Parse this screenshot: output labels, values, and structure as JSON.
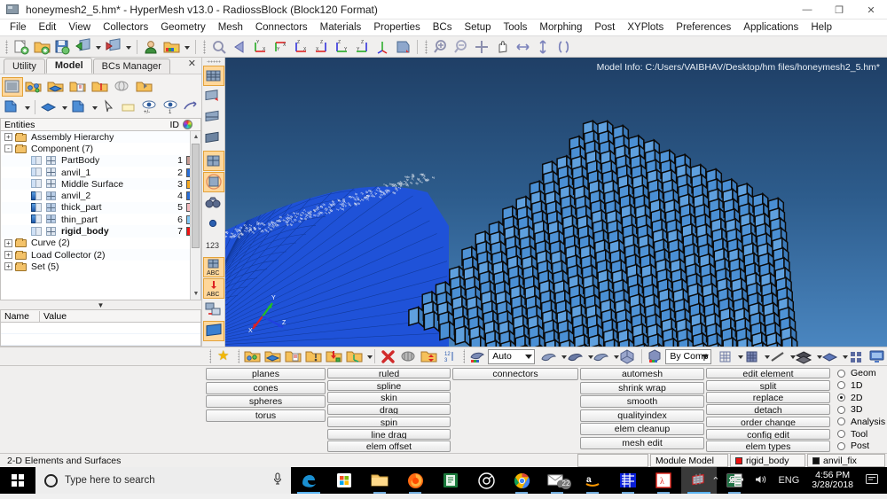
{
  "window": {
    "title": "honeymesh2_5.hm* - HyperMesh v13.0 - RadiossBlock (Block120 Format)",
    "minimize": "—",
    "maximize": "❐",
    "close": "✕"
  },
  "menubar": {
    "items": [
      "File",
      "Edit",
      "View",
      "Collectors",
      "Geometry",
      "Mesh",
      "Connectors",
      "Materials",
      "Properties",
      "BCs",
      "Setup",
      "Tools",
      "Morphing",
      "Post",
      "XYPlots",
      "Preferences",
      "Applications",
      "Help"
    ]
  },
  "toolbar_top": {
    "icons": [
      "new-session-icon",
      "open-model-icon",
      "save-model-icon",
      "import-solver-deck-icon",
      "export-solver-deck-icon",
      "user-profile-icon",
      "color-folder-icon",
      "zoom-window-icon",
      "undo-view-icon",
      "xy-view-icon",
      "yx-view-icon",
      "zx-view-icon",
      "xz-view-icon",
      "zy-view-icon",
      "yz-view-icon",
      "iso-view-icon",
      "flip-view-icon",
      "zoom-in-icon",
      "zoom-out-icon",
      "fit-view-icon",
      "pan-icon",
      "arrow-horizontal-icon",
      "arrow-vertical-icon",
      "circle-center-icon"
    ]
  },
  "left_panel": {
    "tabs": [
      {
        "label": "Utility",
        "active": false
      },
      {
        "label": "Model",
        "active": true
      },
      {
        "label": "BCs Manager",
        "active": false
      }
    ],
    "close_label": "✕",
    "toolbar_row1": [
      "model-browser-icon",
      "assembly-icon",
      "component-icon",
      "include-icon",
      "load-collector-icon",
      "system-icon",
      "property-icon"
    ],
    "toolbar_row2": [
      "display-component-icon",
      "display-geom-icon",
      "display-mesh-icon",
      "select-arrow-icon",
      "note-icon",
      "show-hide-all-icon",
      "isolate-icon",
      "reverse-icon"
    ],
    "headers": {
      "entities": "Entities",
      "id": "ID",
      "color": "color-wheel-icon"
    },
    "tree": [
      {
        "label": "Assembly Hierarchy",
        "id": "",
        "color": "",
        "depth": 0,
        "expander": "+",
        "icon": "assembly-folder-icon",
        "bold": false
      },
      {
        "label": "Component (7)",
        "id": "",
        "color": "",
        "depth": 0,
        "expander": "-",
        "icon": "component-folder-icon",
        "bold": false
      },
      {
        "label": "PartBody",
        "id": "1",
        "color": "#c49a92",
        "depth": 1,
        "expander": "",
        "icon": "component-off-icon",
        "bold": false
      },
      {
        "label": "anvil_1",
        "id": "2",
        "color": "#2a6fd8",
        "depth": 1,
        "expander": "",
        "icon": "component-off-icon",
        "bold": false
      },
      {
        "label": "Middle Surface",
        "id": "3",
        "color": "#f4a71d",
        "depth": 1,
        "expander": "",
        "icon": "component-off-icon",
        "bold": false
      },
      {
        "label": "anvil_2",
        "id": "4",
        "color": "#2a6fd8",
        "depth": 1,
        "expander": "",
        "icon": "component-on-icon",
        "bold": false
      },
      {
        "label": "thick_part",
        "id": "5",
        "color": "#f3b9bd",
        "depth": 1,
        "expander": "",
        "icon": "component-on-icon",
        "bold": false
      },
      {
        "label": "thin_part",
        "id": "6",
        "color": "#7ec5f2",
        "depth": 1,
        "expander": "",
        "icon": "component-on-icon",
        "bold": false
      },
      {
        "label": "rigid_body",
        "id": "7",
        "color": "#ef1111",
        "depth": 1,
        "expander": "",
        "icon": "component-off-icon",
        "bold": true
      },
      {
        "label": "Curve (2)",
        "id": "",
        "color": "",
        "depth": 0,
        "expander": "+",
        "icon": "curve-folder-icon",
        "bold": false
      },
      {
        "label": "Load Collector (2)",
        "id": "",
        "color": "",
        "depth": 0,
        "expander": "+",
        "icon": "load-collector-folder-icon",
        "bold": false
      },
      {
        "label": "Set (5)",
        "id": "",
        "color": "",
        "depth": 0,
        "expander": "+",
        "icon": "set-folder-icon",
        "bold": false
      }
    ],
    "property_table": {
      "columns": [
        "Name",
        "Value"
      ],
      "rows": []
    }
  },
  "vertical_toolbar": {
    "icons": [
      "mesh-display-icon",
      "mesh-edit-icon",
      "shaded-elements-icon",
      "wireframe-elements-icon",
      "mesh-lines-icon",
      "transparency-icon",
      "binoculars-icon",
      "node-dot-icon",
      "numbers-123-icon",
      "element-id-abc-icon",
      "load-abc-icon",
      "mask-icon",
      "shaded-geom-icon"
    ]
  },
  "viewport": {
    "model_info": "Model Info: C:/Users/VAIBHAV/Desktop/hm files/honeymesh2_5.hm*",
    "axis_labels": {
      "x": "X",
      "y": "Y",
      "z": "Z"
    }
  },
  "lower_toolbar": {
    "favorite_icon": "star-icon",
    "icons": [
      "component-collector-icon",
      "property-collector-icon",
      "material-collector-icon",
      "load-collector-create-icon",
      "organize-down-icon",
      "system-collector-icon",
      "delete-icon",
      "mask-elements-icon",
      "reorganize-icon",
      "renumber-123-icon"
    ],
    "mesh_mode": {
      "value": "Auto",
      "icon": "color-mode-icon"
    },
    "shading_icons": [
      "surface-shade-icon",
      "surface-wire-icon",
      "element-shade-icon"
    ],
    "color_mode": {
      "value": "By Comp",
      "icon": "color-mode-icon"
    },
    "display_icons": [
      "3d-wire-icon",
      "3d-solid-icon",
      "line-display-icon",
      "element-stack-icon",
      "surface-display-icon",
      "window-split-icon",
      "monitor-icon"
    ]
  },
  "panel_menu": {
    "columns": [
      [
        "planes",
        "cones",
        "spheres",
        "torus"
      ],
      [
        "ruled",
        "spline",
        "skin",
        "drag",
        "spin",
        "line drag",
        "elem offset"
      ],
      [
        "connectors"
      ],
      [
        "automesh",
        "shrink wrap",
        "smooth",
        "qualityindex",
        "elem cleanup",
        "mesh edit"
      ],
      [
        "edit element",
        "split",
        "replace",
        "detach",
        "order change",
        "config edit",
        "elem types"
      ]
    ],
    "page_radios": [
      {
        "label": "Geom",
        "selected": false
      },
      {
        "label": "1D",
        "selected": false
      },
      {
        "label": "2D",
        "selected": true
      },
      {
        "label": "3D",
        "selected": false
      },
      {
        "label": "Analysis",
        "selected": false
      },
      {
        "label": "Tool",
        "selected": false
      },
      {
        "label": "Post",
        "selected": false
      }
    ]
  },
  "statusbar": {
    "message": "2-D Elements and Surfaces",
    "cells": [
      {
        "text": "",
        "color": ""
      },
      {
        "text": "Module Model",
        "color": ""
      },
      {
        "text": "rigid_body",
        "color": "#ee1111"
      },
      {
        "text": "anvil_fix",
        "color": "#111111"
      }
    ]
  },
  "taskbar": {
    "start": "windows-logo-icon",
    "search_placeholder": "Type here to search",
    "mic_icon": "microphone-icon",
    "apps": [
      {
        "name": "edge-icon",
        "state": "active"
      },
      {
        "name": "microsoft-store-icon",
        "state": "none"
      },
      {
        "name": "file-explorer-icon",
        "state": "running"
      },
      {
        "name": "firefox-icon",
        "state": "running"
      },
      {
        "name": "green-book-icon",
        "state": "none"
      },
      {
        "name": "camera-app-icon",
        "state": "none"
      },
      {
        "name": "chrome-icon",
        "state": "running"
      },
      {
        "name": "mail-icon",
        "state": "running",
        "badge": "22"
      },
      {
        "name": "amazon-icon",
        "state": "running"
      },
      {
        "name": "stc-icon",
        "state": "running"
      },
      {
        "name": "adobe-reader-icon",
        "state": "running"
      },
      {
        "name": "hypermesh-icon",
        "state": "active"
      },
      {
        "name": "excel-icon",
        "state": "running"
      }
    ],
    "tray": {
      "chevron": "show-hidden-icons-icon",
      "battery": "battery-icon",
      "volume": "volume-icon",
      "language": "ENG",
      "time": "4:56 PM",
      "date": "3/28/2018",
      "action_center": "action-center-icon"
    }
  }
}
